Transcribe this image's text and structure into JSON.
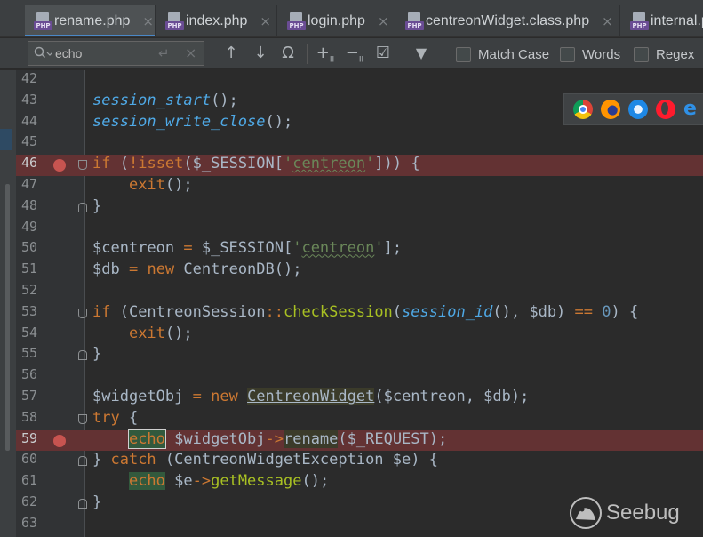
{
  "tabs": [
    {
      "label": "rename.php",
      "active": true,
      "icon": "php-file-icon"
    },
    {
      "label": "index.php",
      "active": false,
      "icon": "php-file-icon"
    },
    {
      "label": "login.php",
      "active": false,
      "icon": "php-file-icon"
    },
    {
      "label": "centreonWidget.class.php",
      "active": false,
      "icon": "php-file-icon"
    },
    {
      "label": "internal.p",
      "active": false,
      "icon": "php-file-icon"
    }
  ],
  "tab_close_glyph": "×",
  "search": {
    "value": "echo",
    "enter_glyph": "↵",
    "clear_glyph": "×",
    "prev_glyph": "↑",
    "next_glyph": "↓",
    "regex_help_glyph": "Ω",
    "add_glyph": "+",
    "remove_glyph": "−",
    "select_all_glyph": "☑",
    "filter_glyph": "▼",
    "match_case_label": "Match Case",
    "words_label": "Words",
    "regex_label": "Regex",
    "match_case_checked": false,
    "words_checked": false,
    "regex_checked": false
  },
  "colors": {
    "background": "#2b2b2b",
    "keyword": "#cc7832",
    "function": "#ffc66d",
    "string": "#6a8759",
    "number": "#6897bb",
    "breakpoint_line": "#633233",
    "breakpoint_dot": "#c75450",
    "search_highlight": "#32593d"
  },
  "lines": [
    {
      "n": "42",
      "bp": false,
      "fold": "",
      "tokens": []
    },
    {
      "n": "43",
      "bp": false,
      "fold": "",
      "tokens": [
        [
          "ifn",
          "session_start"
        ],
        [
          "p",
          "();"
        ]
      ]
    },
    {
      "n": "44",
      "bp": false,
      "fold": "",
      "tokens": [
        [
          "ifn",
          "session_write_close"
        ],
        [
          "p",
          "();"
        ]
      ]
    },
    {
      "n": "45",
      "bp": false,
      "fold": "",
      "tokens": []
    },
    {
      "n": "46",
      "bp": true,
      "fold": "open",
      "tokens": [
        [
          "kw",
          "if"
        ],
        [
          "p",
          " ("
        ],
        [
          "kw",
          "!"
        ],
        [
          "kw",
          "isset"
        ],
        [
          "p",
          "($_SESSION["
        ],
        [
          "st",
          "'"
        ],
        [
          "stu",
          "centreon"
        ],
        [
          "st",
          "'"
        ],
        [
          "p",
          "])) {"
        ]
      ]
    },
    {
      "n": "47",
      "bp": false,
      "fold": "",
      "tokens": [
        [
          "p",
          "    "
        ],
        [
          "kw",
          "exit"
        ],
        [
          "p",
          "();"
        ]
      ]
    },
    {
      "n": "48",
      "bp": false,
      "fold": "close",
      "tokens": [
        [
          "p",
          "}"
        ]
      ]
    },
    {
      "n": "49",
      "bp": false,
      "fold": "",
      "tokens": []
    },
    {
      "n": "50",
      "bp": false,
      "fold": "",
      "tokens": [
        [
          "p",
          "$centreon "
        ],
        [
          "kw",
          "="
        ],
        [
          "p",
          " $_SESSION["
        ],
        [
          "st",
          "'"
        ],
        [
          "stu",
          "centreon"
        ],
        [
          "st",
          "'"
        ],
        [
          "p",
          "];"
        ]
      ]
    },
    {
      "n": "51",
      "bp": false,
      "fold": "",
      "tokens": [
        [
          "p",
          "$db "
        ],
        [
          "kw",
          "="
        ],
        [
          "p",
          " "
        ],
        [
          "kw",
          "new"
        ],
        [
          "p",
          " CentreonDB();"
        ]
      ]
    },
    {
      "n": "52",
      "bp": false,
      "fold": "",
      "tokens": []
    },
    {
      "n": "53",
      "bp": false,
      "fold": "open",
      "tokens": [
        [
          "kw",
          "if"
        ],
        [
          "p",
          " (CentreonSession"
        ],
        [
          "sp",
          "::"
        ],
        [
          "mth",
          "checkSession"
        ],
        [
          "p",
          "("
        ],
        [
          "ifn",
          "session_id"
        ],
        [
          "p",
          "(), $db) "
        ],
        [
          "kw",
          "=="
        ],
        [
          "p",
          " "
        ],
        [
          "nm",
          "0"
        ],
        [
          "p",
          ") {"
        ]
      ]
    },
    {
      "n": "54",
      "bp": false,
      "fold": "",
      "tokens": [
        [
          "p",
          "    "
        ],
        [
          "kw",
          "exit"
        ],
        [
          "p",
          "();"
        ]
      ]
    },
    {
      "n": "55",
      "bp": false,
      "fold": "close",
      "tokens": [
        [
          "p",
          "}"
        ]
      ]
    },
    {
      "n": "56",
      "bp": false,
      "fold": "",
      "tokens": []
    },
    {
      "n": "57",
      "bp": false,
      "fold": "",
      "tokens": [
        [
          "p",
          "$widgetObj "
        ],
        [
          "kw",
          "="
        ],
        [
          "p",
          " "
        ],
        [
          "kw",
          "new"
        ],
        [
          "p",
          " "
        ],
        [
          "cls",
          "CentreonWidget"
        ],
        [
          "p",
          "($centreon, $db);"
        ]
      ]
    },
    {
      "n": "58",
      "bp": false,
      "fold": "open",
      "tokens": [
        [
          "kw",
          "try"
        ],
        [
          "p",
          " {"
        ]
      ]
    },
    {
      "n": "59",
      "bp": true,
      "fold": "",
      "tokens": [
        [
          "p",
          "    "
        ],
        [
          "hlc",
          "echo"
        ],
        [
          "p",
          " $widgetObj"
        ],
        [
          "sp",
          "->"
        ],
        [
          "cls",
          "rename"
        ],
        [
          "p",
          "($_REQUEST);"
        ]
      ]
    },
    {
      "n": "60",
      "bp": false,
      "fold": "close",
      "tokens": [
        [
          "p",
          "} "
        ],
        [
          "kw",
          "catch"
        ],
        [
          "p",
          " (CentreonWidgetException $e) {"
        ]
      ]
    },
    {
      "n": "61",
      "bp": false,
      "fold": "",
      "tokens": [
        [
          "p",
          "    "
        ],
        [
          "hl",
          "echo"
        ],
        [
          "p",
          " $e"
        ],
        [
          "sp",
          "->"
        ],
        [
          "mth",
          "getMessage"
        ],
        [
          "p",
          "();"
        ]
      ]
    },
    {
      "n": "62",
      "bp": false,
      "fold": "close",
      "tokens": [
        [
          "p",
          "}"
        ]
      ]
    },
    {
      "n": "63",
      "bp": false,
      "fold": "",
      "tokens": []
    }
  ],
  "browsers": [
    "chrome-icon",
    "firefox-icon",
    "safari-icon",
    "opera-icon",
    "edge-icon"
  ],
  "edge_glyph": "e",
  "watermark": {
    "text": "Seebug"
  }
}
